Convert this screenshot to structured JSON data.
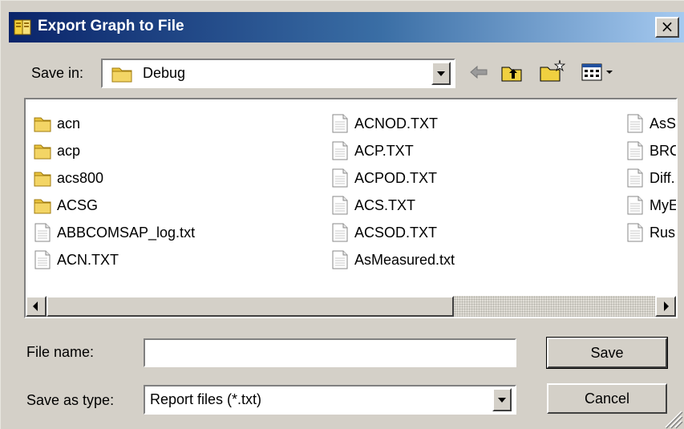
{
  "window": {
    "title": "Export Graph to File",
    "close_label": "×"
  },
  "toolbar": {
    "save_in_label": "Save in:",
    "save_in_value": "Debug",
    "icons": [
      "back-arrow-icon",
      "up-folder-icon",
      "new-folder-icon",
      "view-menu-icon"
    ]
  },
  "files": [
    {
      "name": "acn",
      "type": "folder"
    },
    {
      "name": "acp",
      "type": "folder"
    },
    {
      "name": "acs800",
      "type": "folder"
    },
    {
      "name": "ACSG",
      "type": "folder"
    },
    {
      "name": "ABBCOMSAP_log.txt",
      "type": "file"
    },
    {
      "name": "ACN.TXT",
      "type": "file"
    },
    {
      "name": "ACNOD.TXT",
      "type": "file"
    },
    {
      "name": "ACP.TXT",
      "type": "file"
    },
    {
      "name": "ACPOD.TXT",
      "type": "file"
    },
    {
      "name": "ACS.TXT",
      "type": "file"
    },
    {
      "name": "ACSOD.TXT",
      "type": "file"
    },
    {
      "name": "AsMeasured.txt",
      "type": "file"
    },
    {
      "name": "AsS",
      "type": "file"
    },
    {
      "name": "BRC",
      "type": "file"
    },
    {
      "name": "Diff.",
      "type": "file"
    },
    {
      "name": "MyE",
      "type": "file"
    },
    {
      "name": "Rus",
      "type": "file"
    }
  ],
  "form": {
    "file_name_label": "File name:",
    "file_name_value": "",
    "save_type_label": "Save as type:",
    "save_type_value": "Report files (*.txt)"
  },
  "buttons": {
    "save": "Save",
    "cancel": "Cancel"
  },
  "colors": {
    "title_gradient_start": "#0a246a",
    "title_gradient_end": "#a6caf0",
    "face": "#d4d0c8",
    "folder_yellow": "#e8c23c"
  }
}
